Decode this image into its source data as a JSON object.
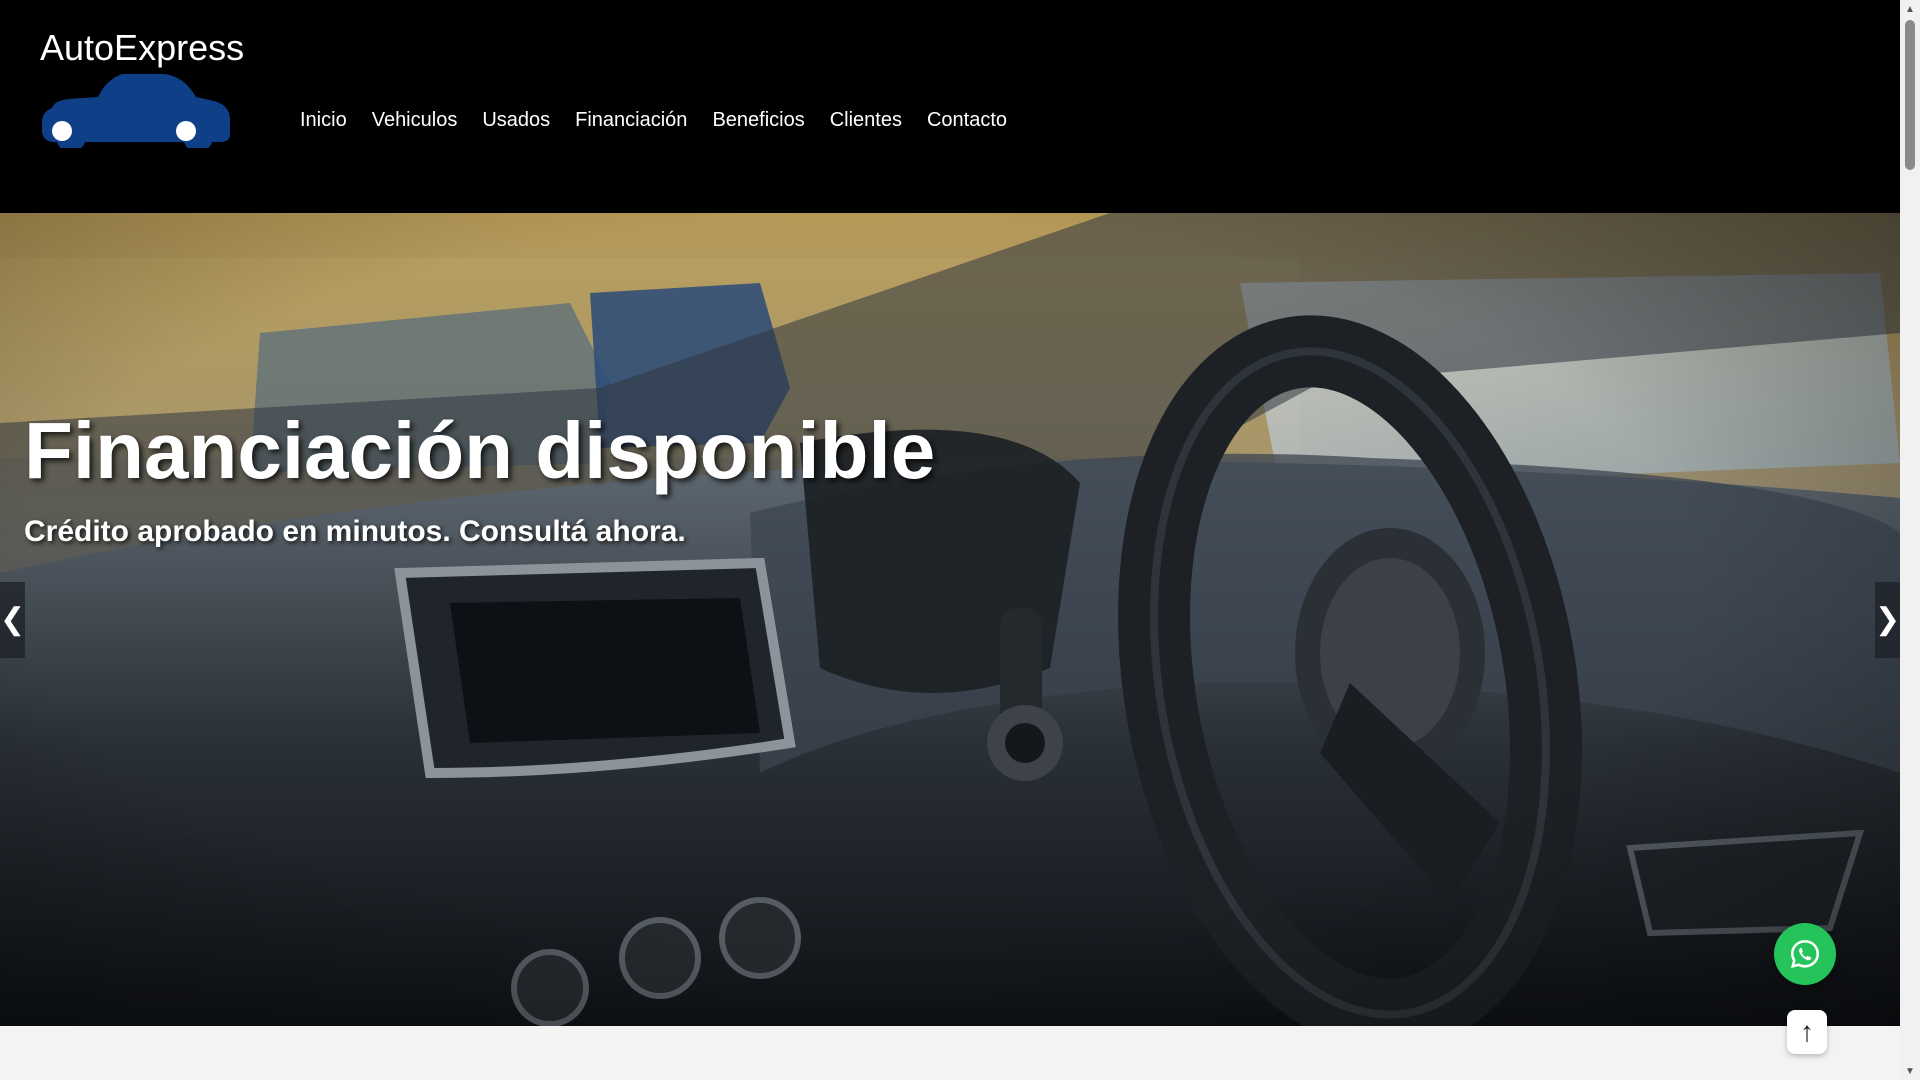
{
  "brand": {
    "name": "AutoExpress",
    "color": "#0f3f86"
  },
  "nav": {
    "items": [
      {
        "label": "Inicio"
      },
      {
        "label": "Vehiculos"
      },
      {
        "label": "Usados"
      },
      {
        "label": "Financiación"
      },
      {
        "label": "Beneficios"
      },
      {
        "label": "Clientes"
      },
      {
        "label": "Contacto"
      }
    ]
  },
  "hero": {
    "title": "Financiación disponible",
    "subtitle": "Crédito aprobado en minutos. Consultá ahora.",
    "prev_icon": "❮",
    "next_icon": "❯"
  },
  "floating": {
    "whatsapp_icon": "whatsapp-icon",
    "whatsapp_color": "#25c45a",
    "top_icon": "↑"
  },
  "scrollbar": {
    "up_icon": "▲",
    "down_icon": "▼"
  }
}
